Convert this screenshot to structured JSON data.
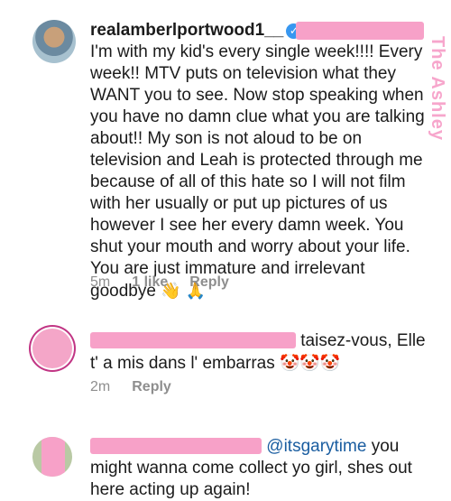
{
  "watermark": "The Ashley",
  "comments": [
    {
      "username": "realamberlportwood1__",
      "body": "I'm with my kid's every single week!!!! Every week!! MTV puts on television what they WANT you to see. Now stop speaking when you have no damn clue what you are talking about!! My son is not aloud to be on television and Leah is protected through me because of all of this hate so I will not film with her usually or put up pictures of us however I see her every damn week. You shut your mouth and worry about your life. You are just immature and irrelevant goodbye",
      "emoji": "👋 🙏",
      "time": "5m",
      "likes": "1 like",
      "reply": "Reply"
    },
    {
      "body": "taisez-vous, Elle t' a mis dans l' embarras",
      "emoji": "🤡🤡🤡",
      "time": "2m",
      "reply": "Reply"
    },
    {
      "mention": "@itsgarytime",
      "body": " you might wanna come collect yo girl, shes out here acting up again!"
    }
  ]
}
